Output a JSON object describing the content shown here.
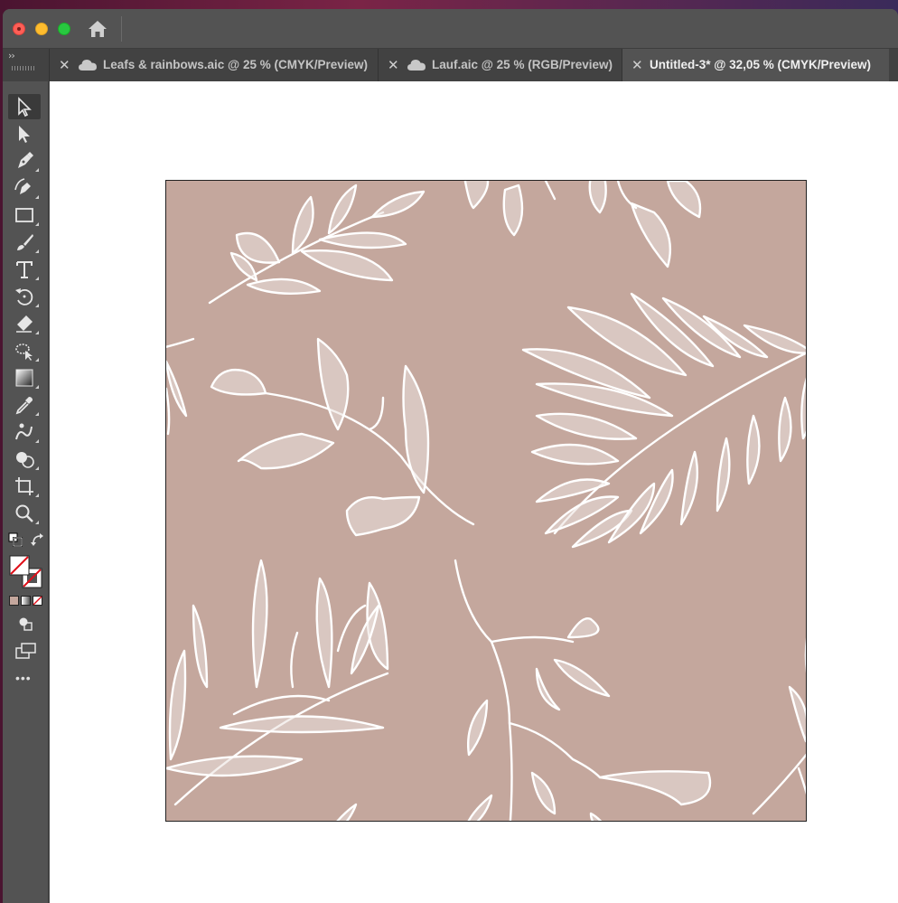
{
  "window": {
    "controls": {
      "close_icon": "close-dot",
      "minimize_icon": "minimize-dot",
      "maximize_icon": "maximize-dot"
    },
    "home_icon": "home-icon"
  },
  "tabs": [
    {
      "label": "Leafs & rainbows.aic @ 25 % (CMYK/Preview)",
      "cloud": true,
      "active": false
    },
    {
      "label": "Lauf.aic @ 25 % (RGB/Preview)",
      "cloud": true,
      "active": false
    },
    {
      "label": "Untitled-3* @ 32,05 % (CMYK/Preview)",
      "cloud": false,
      "active": true
    }
  ],
  "tab_collapse_label": "››",
  "toolbar": {
    "tools": [
      "selection-tool-icon",
      "direct-selection-tool-icon",
      "pen-tool-icon",
      "curvature-tool-icon",
      "rectangle-tool-icon",
      "paintbrush-tool-icon",
      "type-tool-icon",
      "rotate-tool-icon",
      "eraser-tool-icon",
      "puppet-warp-tool-icon",
      "gradient-tool-icon",
      "eyedropper-tool-icon",
      "blend-tool-icon",
      "shape-builder-tool-icon",
      "artboard-tool-icon",
      "zoom-tool-icon"
    ],
    "more_label": "•••"
  },
  "artboard": {
    "background": "#c4a79d",
    "leaf_color": "#ffffff",
    "leaf_fill": "#ebe2de"
  },
  "colors": {
    "chrome": "#535353",
    "tabbar": "#424242",
    "fill_none_red": "#e0101a"
  }
}
